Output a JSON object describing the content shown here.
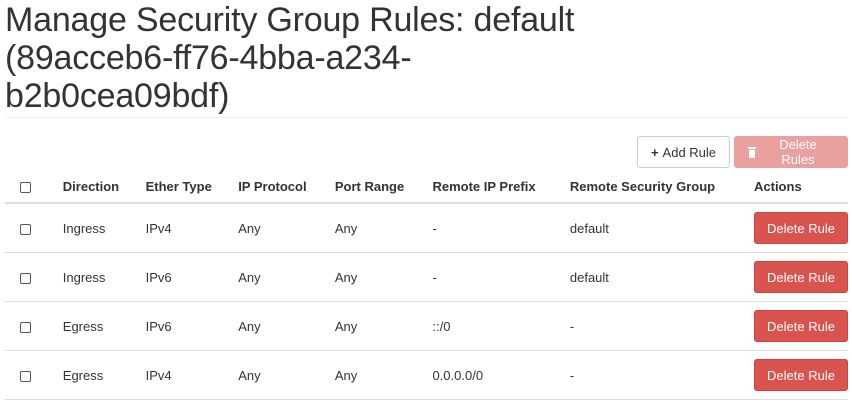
{
  "page": {
    "title": "Manage Security Group Rules: default (89acceb6-ff76-4bba-a234-b2b0cea09bdf)"
  },
  "toolbar": {
    "add_rule_icon": "plus-icon",
    "add_rule_label": "Add Rule",
    "delete_rules_icon": "trash-icon",
    "delete_rules_label": "Delete Rules"
  },
  "table": {
    "columns": [
      "Direction",
      "Ether Type",
      "IP Protocol",
      "Port Range",
      "Remote IP Prefix",
      "Remote Security Group",
      "Actions"
    ],
    "rows": [
      {
        "direction": "Ingress",
        "ether_type": "IPv4",
        "ip_protocol": "Any",
        "port_range": "Any",
        "remote_ip_prefix": "-",
        "remote_security_group": "default",
        "action_label": "Delete Rule"
      },
      {
        "direction": "Ingress",
        "ether_type": "IPv6",
        "ip_protocol": "Any",
        "port_range": "Any",
        "remote_ip_prefix": "-",
        "remote_security_group": "default",
        "action_label": "Delete Rule"
      },
      {
        "direction": "Egress",
        "ether_type": "IPv6",
        "ip_protocol": "Any",
        "port_range": "Any",
        "remote_ip_prefix": "::/0",
        "remote_security_group": "-",
        "action_label": "Delete Rule"
      },
      {
        "direction": "Egress",
        "ether_type": "IPv4",
        "ip_protocol": "Any",
        "port_range": "Any",
        "remote_ip_prefix": "0.0.0.0/0",
        "remote_security_group": "-",
        "action_label": "Delete Rule"
      }
    ]
  },
  "colors": {
    "danger": "#d9534f",
    "danger_disabled": "#e9a09e",
    "border": "#dddddd"
  }
}
